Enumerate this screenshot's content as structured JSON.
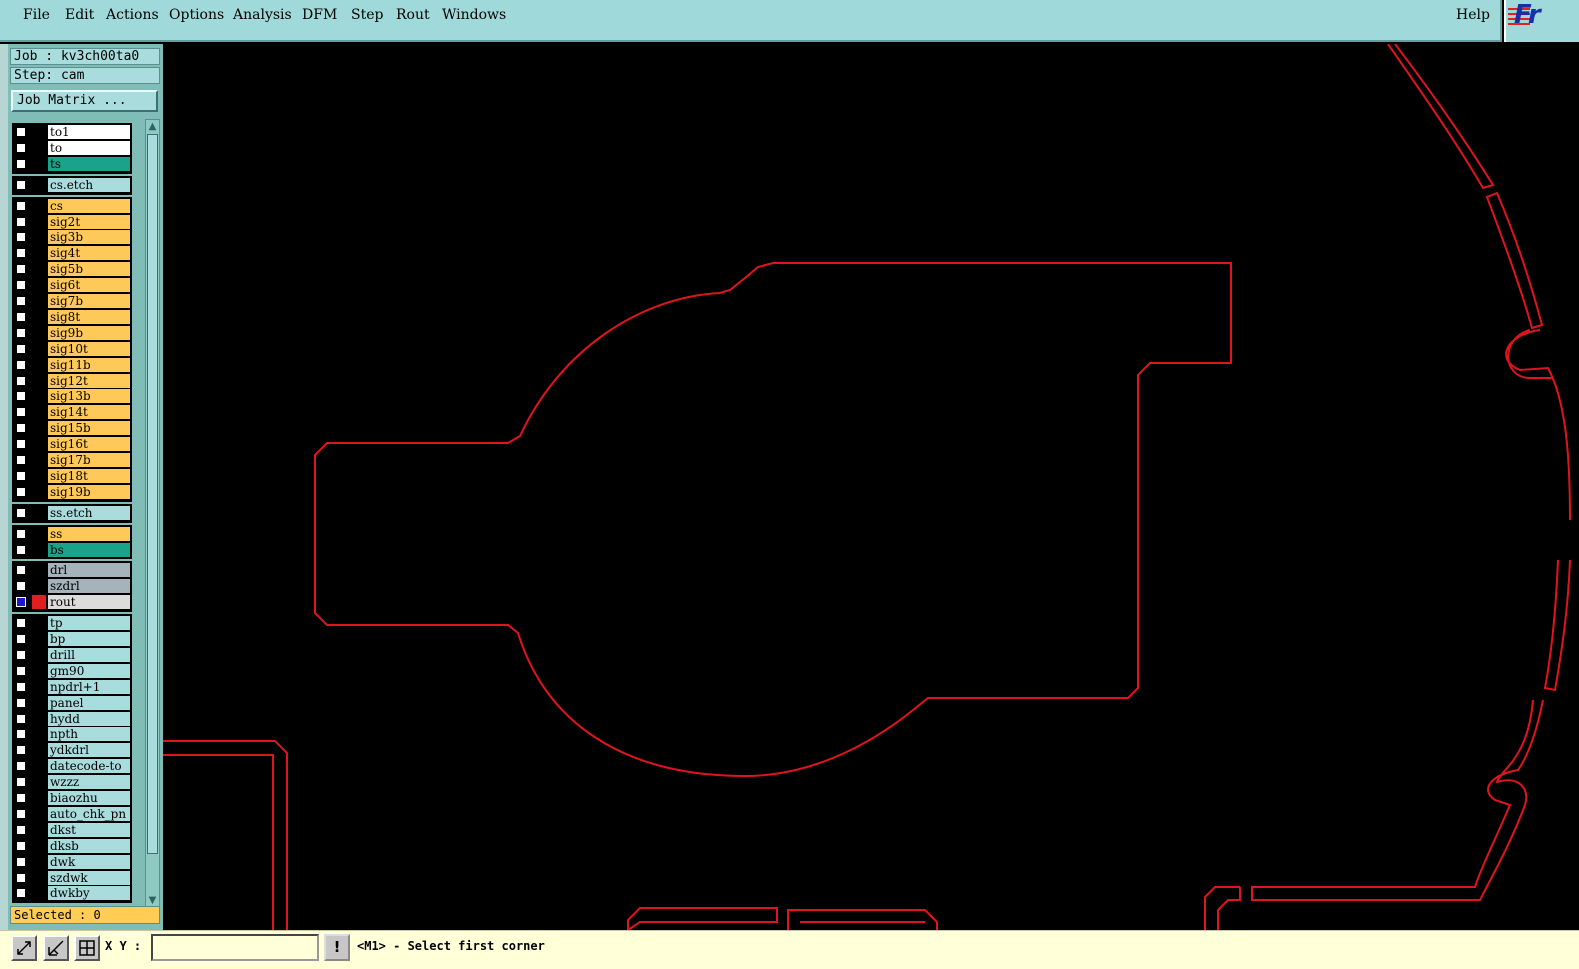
{
  "menu": {
    "file": "File",
    "edit": "Edit",
    "actions": "Actions",
    "options": "Options",
    "analysis": "Analysis",
    "dfm": "DFM",
    "step": "Step",
    "rout": "Rout",
    "windows": "Windows",
    "help": "Help"
  },
  "logo": {
    "text": "Fr"
  },
  "job": {
    "label": "Job : kv3ch00ta0",
    "step": "Step: cam",
    "matrix_button": "Job Matrix ..."
  },
  "layers": [
    {
      "name": "to1",
      "color": "#ffffff"
    },
    {
      "name": "to",
      "color": "#ffffff"
    },
    {
      "name": "ts",
      "color": "#1aa38a"
    },
    {
      "name": "cs.etch",
      "color": "#a9dcdc"
    },
    {
      "name": "cs",
      "color": "#ffc95a"
    },
    {
      "name": "sig2t",
      "color": "#ffc95a"
    },
    {
      "name": "sig3b",
      "color": "#ffc95a"
    },
    {
      "name": "sig4t",
      "color": "#ffc95a"
    },
    {
      "name": "sig5b",
      "color": "#ffc95a"
    },
    {
      "name": "sig6t",
      "color": "#ffc95a"
    },
    {
      "name": "sig7b",
      "color": "#ffc95a"
    },
    {
      "name": "sig8t",
      "color": "#ffc95a"
    },
    {
      "name": "sig9b",
      "color": "#ffc95a"
    },
    {
      "name": "sig10t",
      "color": "#ffc95a"
    },
    {
      "name": "sig11b",
      "color": "#ffc95a"
    },
    {
      "name": "sig12t",
      "color": "#ffc95a"
    },
    {
      "name": "sig13b",
      "color": "#ffc95a"
    },
    {
      "name": "sig14t",
      "color": "#ffc95a"
    },
    {
      "name": "sig15b",
      "color": "#ffc95a"
    },
    {
      "name": "sig16t",
      "color": "#ffc95a"
    },
    {
      "name": "sig17b",
      "color": "#ffc95a"
    },
    {
      "name": "sig18t",
      "color": "#ffc95a"
    },
    {
      "name": "sig19b",
      "color": "#ffc95a"
    },
    {
      "name": "ss.etch",
      "color": "#a9dcdc"
    },
    {
      "name": "ss",
      "color": "#ffc95a"
    },
    {
      "name": "bs",
      "color": "#1aa38a"
    },
    {
      "name": "drl",
      "color": "#a7b3bb"
    },
    {
      "name": "szdrl",
      "color": "#a7b3bb"
    },
    {
      "name": "rout",
      "color": "#dcdcdc",
      "active": true
    },
    {
      "name": "tp",
      "color": "#a9dcdc"
    },
    {
      "name": "bp",
      "color": "#a9dcdc"
    },
    {
      "name": "drill",
      "color": "#a9dcdc"
    },
    {
      "name": "gm90",
      "color": "#a9dcdc"
    },
    {
      "name": "npdrl+1",
      "color": "#a9dcdc"
    },
    {
      "name": "panel",
      "color": "#a9dcdc"
    },
    {
      "name": "hydd",
      "color": "#a9dcdc"
    },
    {
      "name": "npth",
      "color": "#a9dcdc"
    },
    {
      "name": "ydkdrl",
      "color": "#a9dcdc"
    },
    {
      "name": "datecode-to",
      "color": "#a9dcdc"
    },
    {
      "name": "wzzz",
      "color": "#a9dcdc"
    },
    {
      "name": "biaozhu",
      "color": "#a9dcdc"
    },
    {
      "name": "auto_chk_pn",
      "color": "#a9dcdc"
    },
    {
      "name": "dkst",
      "color": "#a9dcdc"
    },
    {
      "name": "dksb",
      "color": "#a9dcdc"
    },
    {
      "name": "dwk",
      "color": "#a9dcdc"
    },
    {
      "name": "szdwk",
      "color": "#a9dcdc"
    },
    {
      "name": "dwkby",
      "color": "#a9dcdc"
    }
  ],
  "status": {
    "selected": "Selected : 0"
  },
  "bottom": {
    "xy_label": "X Y :",
    "xy_value": "",
    "excl": "!",
    "prompt": "<M1> - Select first corner"
  },
  "colors": {
    "menu_bg": "#9fd9d9",
    "canvas_bg": "#000000",
    "rout_stroke": "#e0141e",
    "prompt_bg": "#ffffd8"
  }
}
